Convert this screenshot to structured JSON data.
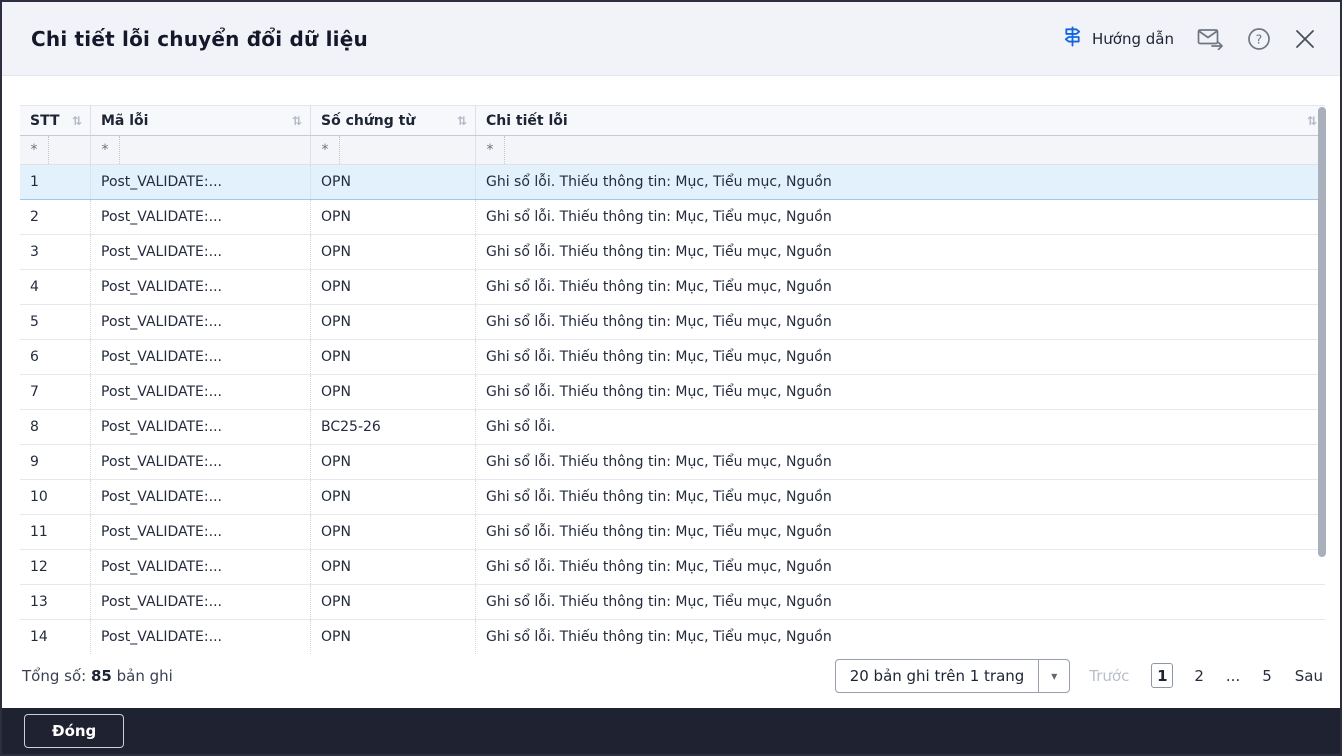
{
  "dialog": {
    "title": "Chi tiết lỗi chuyển đổi dữ liệu",
    "actions": {
      "guide_label": "Hướng dẫn"
    }
  },
  "icons": {
    "sort": "⇅",
    "caret": "▾"
  },
  "table": {
    "columns": [
      {
        "key": "stt",
        "label": "STT"
      },
      {
        "key": "ma_loi",
        "label": "Mã lỗi"
      },
      {
        "key": "so_chung_tu",
        "label": "Số chứng từ"
      },
      {
        "key": "chi_tiet_loi",
        "label": "Chi tiết lỗi"
      }
    ],
    "filter_operator": "*",
    "rows": [
      {
        "stt": "1",
        "ma_loi": "Post_VALIDATE:...",
        "so_chung_tu": "OPN",
        "chi_tiet_loi": "Ghi sổ lỗi. Thiếu thông tin: Mục, Tiểu mục, Nguồn",
        "selected": true
      },
      {
        "stt": "2",
        "ma_loi": "Post_VALIDATE:...",
        "so_chung_tu": "OPN",
        "chi_tiet_loi": "Ghi sổ lỗi. Thiếu thông tin: Mục, Tiểu mục, Nguồn"
      },
      {
        "stt": "3",
        "ma_loi": "Post_VALIDATE:...",
        "so_chung_tu": "OPN",
        "chi_tiet_loi": "Ghi sổ lỗi. Thiếu thông tin: Mục, Tiểu mục, Nguồn"
      },
      {
        "stt": "4",
        "ma_loi": "Post_VALIDATE:...",
        "so_chung_tu": "OPN",
        "chi_tiet_loi": "Ghi sổ lỗi. Thiếu thông tin: Mục, Tiểu mục, Nguồn"
      },
      {
        "stt": "5",
        "ma_loi": "Post_VALIDATE:...",
        "so_chung_tu": "OPN",
        "chi_tiet_loi": "Ghi sổ lỗi. Thiếu thông tin: Mục, Tiểu mục, Nguồn"
      },
      {
        "stt": "6",
        "ma_loi": "Post_VALIDATE:...",
        "so_chung_tu": "OPN",
        "chi_tiet_loi": "Ghi sổ lỗi. Thiếu thông tin: Mục, Tiểu mục, Nguồn"
      },
      {
        "stt": "7",
        "ma_loi": "Post_VALIDATE:...",
        "so_chung_tu": "OPN",
        "chi_tiet_loi": "Ghi sổ lỗi. Thiếu thông tin: Mục, Tiểu mục, Nguồn"
      },
      {
        "stt": "8",
        "ma_loi": "Post_VALIDATE:...",
        "so_chung_tu": "BC25-26",
        "chi_tiet_loi": "Ghi sổ lỗi."
      },
      {
        "stt": "9",
        "ma_loi": "Post_VALIDATE:...",
        "so_chung_tu": "OPN",
        "chi_tiet_loi": "Ghi sổ lỗi. Thiếu thông tin: Mục, Tiểu mục, Nguồn"
      },
      {
        "stt": "10",
        "ma_loi": "Post_VALIDATE:...",
        "so_chung_tu": "OPN",
        "chi_tiet_loi": "Ghi sổ lỗi. Thiếu thông tin: Mục, Tiểu mục, Nguồn"
      },
      {
        "stt": "11",
        "ma_loi": "Post_VALIDATE:...",
        "so_chung_tu": "OPN",
        "chi_tiet_loi": "Ghi sổ lỗi. Thiếu thông tin: Mục, Tiểu mục, Nguồn"
      },
      {
        "stt": "12",
        "ma_loi": "Post_VALIDATE:...",
        "so_chung_tu": "OPN",
        "chi_tiet_loi": "Ghi sổ lỗi. Thiếu thông tin: Mục, Tiểu mục, Nguồn"
      },
      {
        "stt": "13",
        "ma_loi": "Post_VALIDATE:...",
        "so_chung_tu": "OPN",
        "chi_tiet_loi": "Ghi sổ lỗi. Thiếu thông tin: Mục, Tiểu mục, Nguồn"
      },
      {
        "stt": "14",
        "ma_loi": "Post_VALIDATE:...",
        "so_chung_tu": "OPN",
        "chi_tiet_loi": "Ghi sổ lỗi. Thiếu thông tin: Mục, Tiểu mục, Nguồn"
      }
    ]
  },
  "pager": {
    "total_label": "Tổng số:",
    "total_value": "85",
    "total_unit": "bản ghi",
    "page_size_selected": "20 bản ghi trên 1 trang",
    "prev_label": "Trước",
    "next_label": "Sau",
    "pages": [
      "1",
      "2",
      "...",
      "5"
    ],
    "current_page": "1"
  },
  "footer": {
    "close_label": "Đóng"
  },
  "colors": {
    "accent_blue": "#1266e3",
    "header_bg": "#f2f3f8",
    "footer_bg": "#1e2231",
    "selected_row_bg": "#e3f1fd",
    "selected_row_border": "#9ec8f2"
  }
}
